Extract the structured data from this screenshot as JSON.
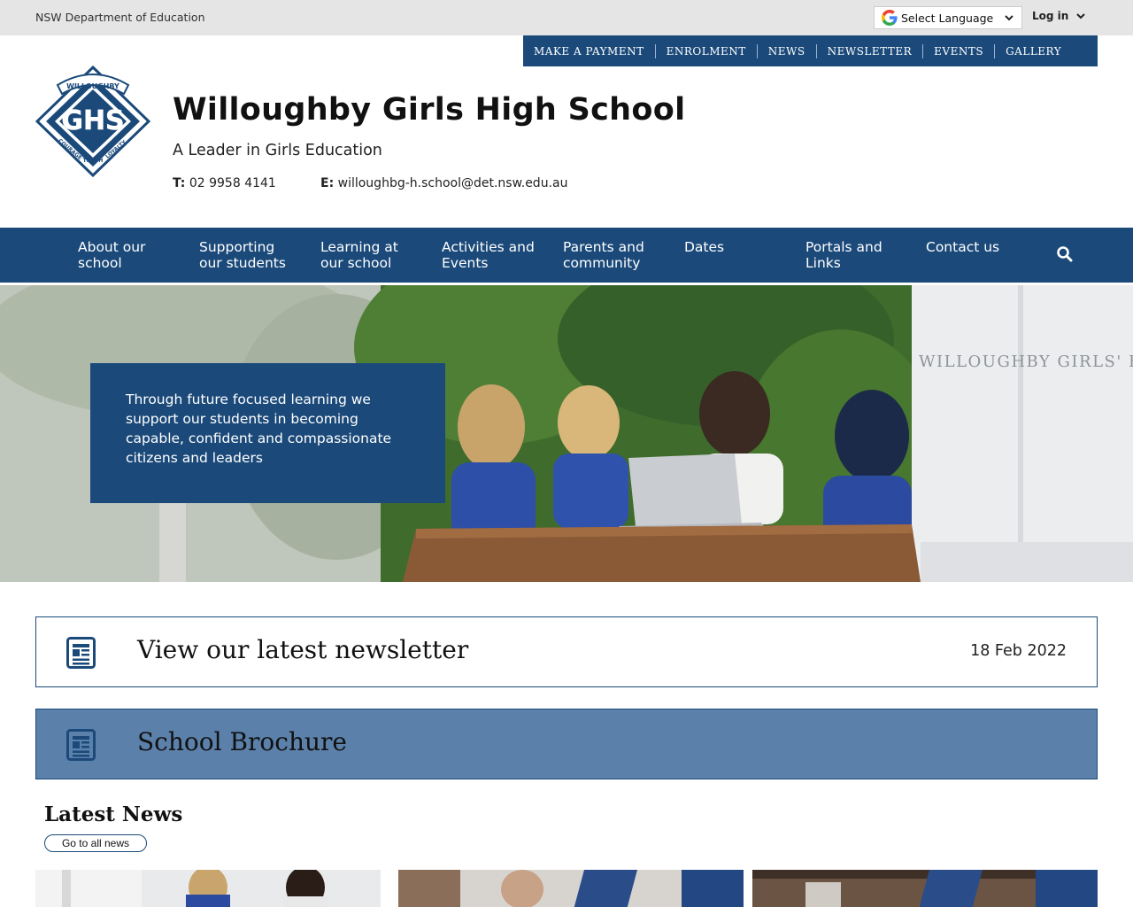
{
  "utility": {
    "department": "NSW Department of Education",
    "language_label": "Select Language",
    "login_label": "Log in"
  },
  "quick_links": [
    "MAKE A PAYMENT",
    "ENROLMENT",
    "NEWS",
    "NEWSLETTER",
    "EVENTS",
    "GALLERY"
  ],
  "header": {
    "school_name": "Willoughby Girls High School",
    "tagline": "A Leader in Girls Education",
    "phone_label": "T:",
    "phone": "02 9958 4141",
    "email_label": "E:",
    "email": "willoughbg-h.school@det.nsw.edu.au",
    "crest": {
      "top_text": "WILLOUGHBY",
      "initials": "GHS",
      "left_text": "COURAGE",
      "right_text": "LOYALTY",
      "bottom_text": "TRUTH"
    }
  },
  "main_nav": [
    {
      "line1": "About our",
      "line2": "school"
    },
    {
      "line1": "Supporting",
      "line2": "our students"
    },
    {
      "line1": "Learning at",
      "line2": "our school"
    },
    {
      "line1": "Activities and",
      "line2": "Events"
    },
    {
      "line1": "Parents and",
      "line2": "community"
    },
    {
      "line1": "Dates",
      "line2": ""
    },
    {
      "line1": "Portals and",
      "line2": "Links"
    },
    {
      "line1": "Contact us",
      "line2": ""
    }
  ],
  "hero": {
    "message": "Through future focused learning we support our students in becoming capable, confident and compassionate citizens and leaders",
    "building_sign": "WILLOUGHBY GIRLS' H"
  },
  "newsletter_bar": {
    "title": "View our latest newsletter",
    "date": "18 Feb 2022"
  },
  "brochure_bar": {
    "title": "School Brochure"
  },
  "latest_news": {
    "heading": "Latest News",
    "button_label": "Go to all news"
  },
  "colors": {
    "brand_navy": "#1b4a7a",
    "brochure_blue": "#5b80aa",
    "utility_grey": "#e5e5e5"
  },
  "icons": {
    "search": "search-icon",
    "document": "newsletter-icon",
    "language": "google-icon",
    "dropdown": "chevron-down-icon"
  }
}
